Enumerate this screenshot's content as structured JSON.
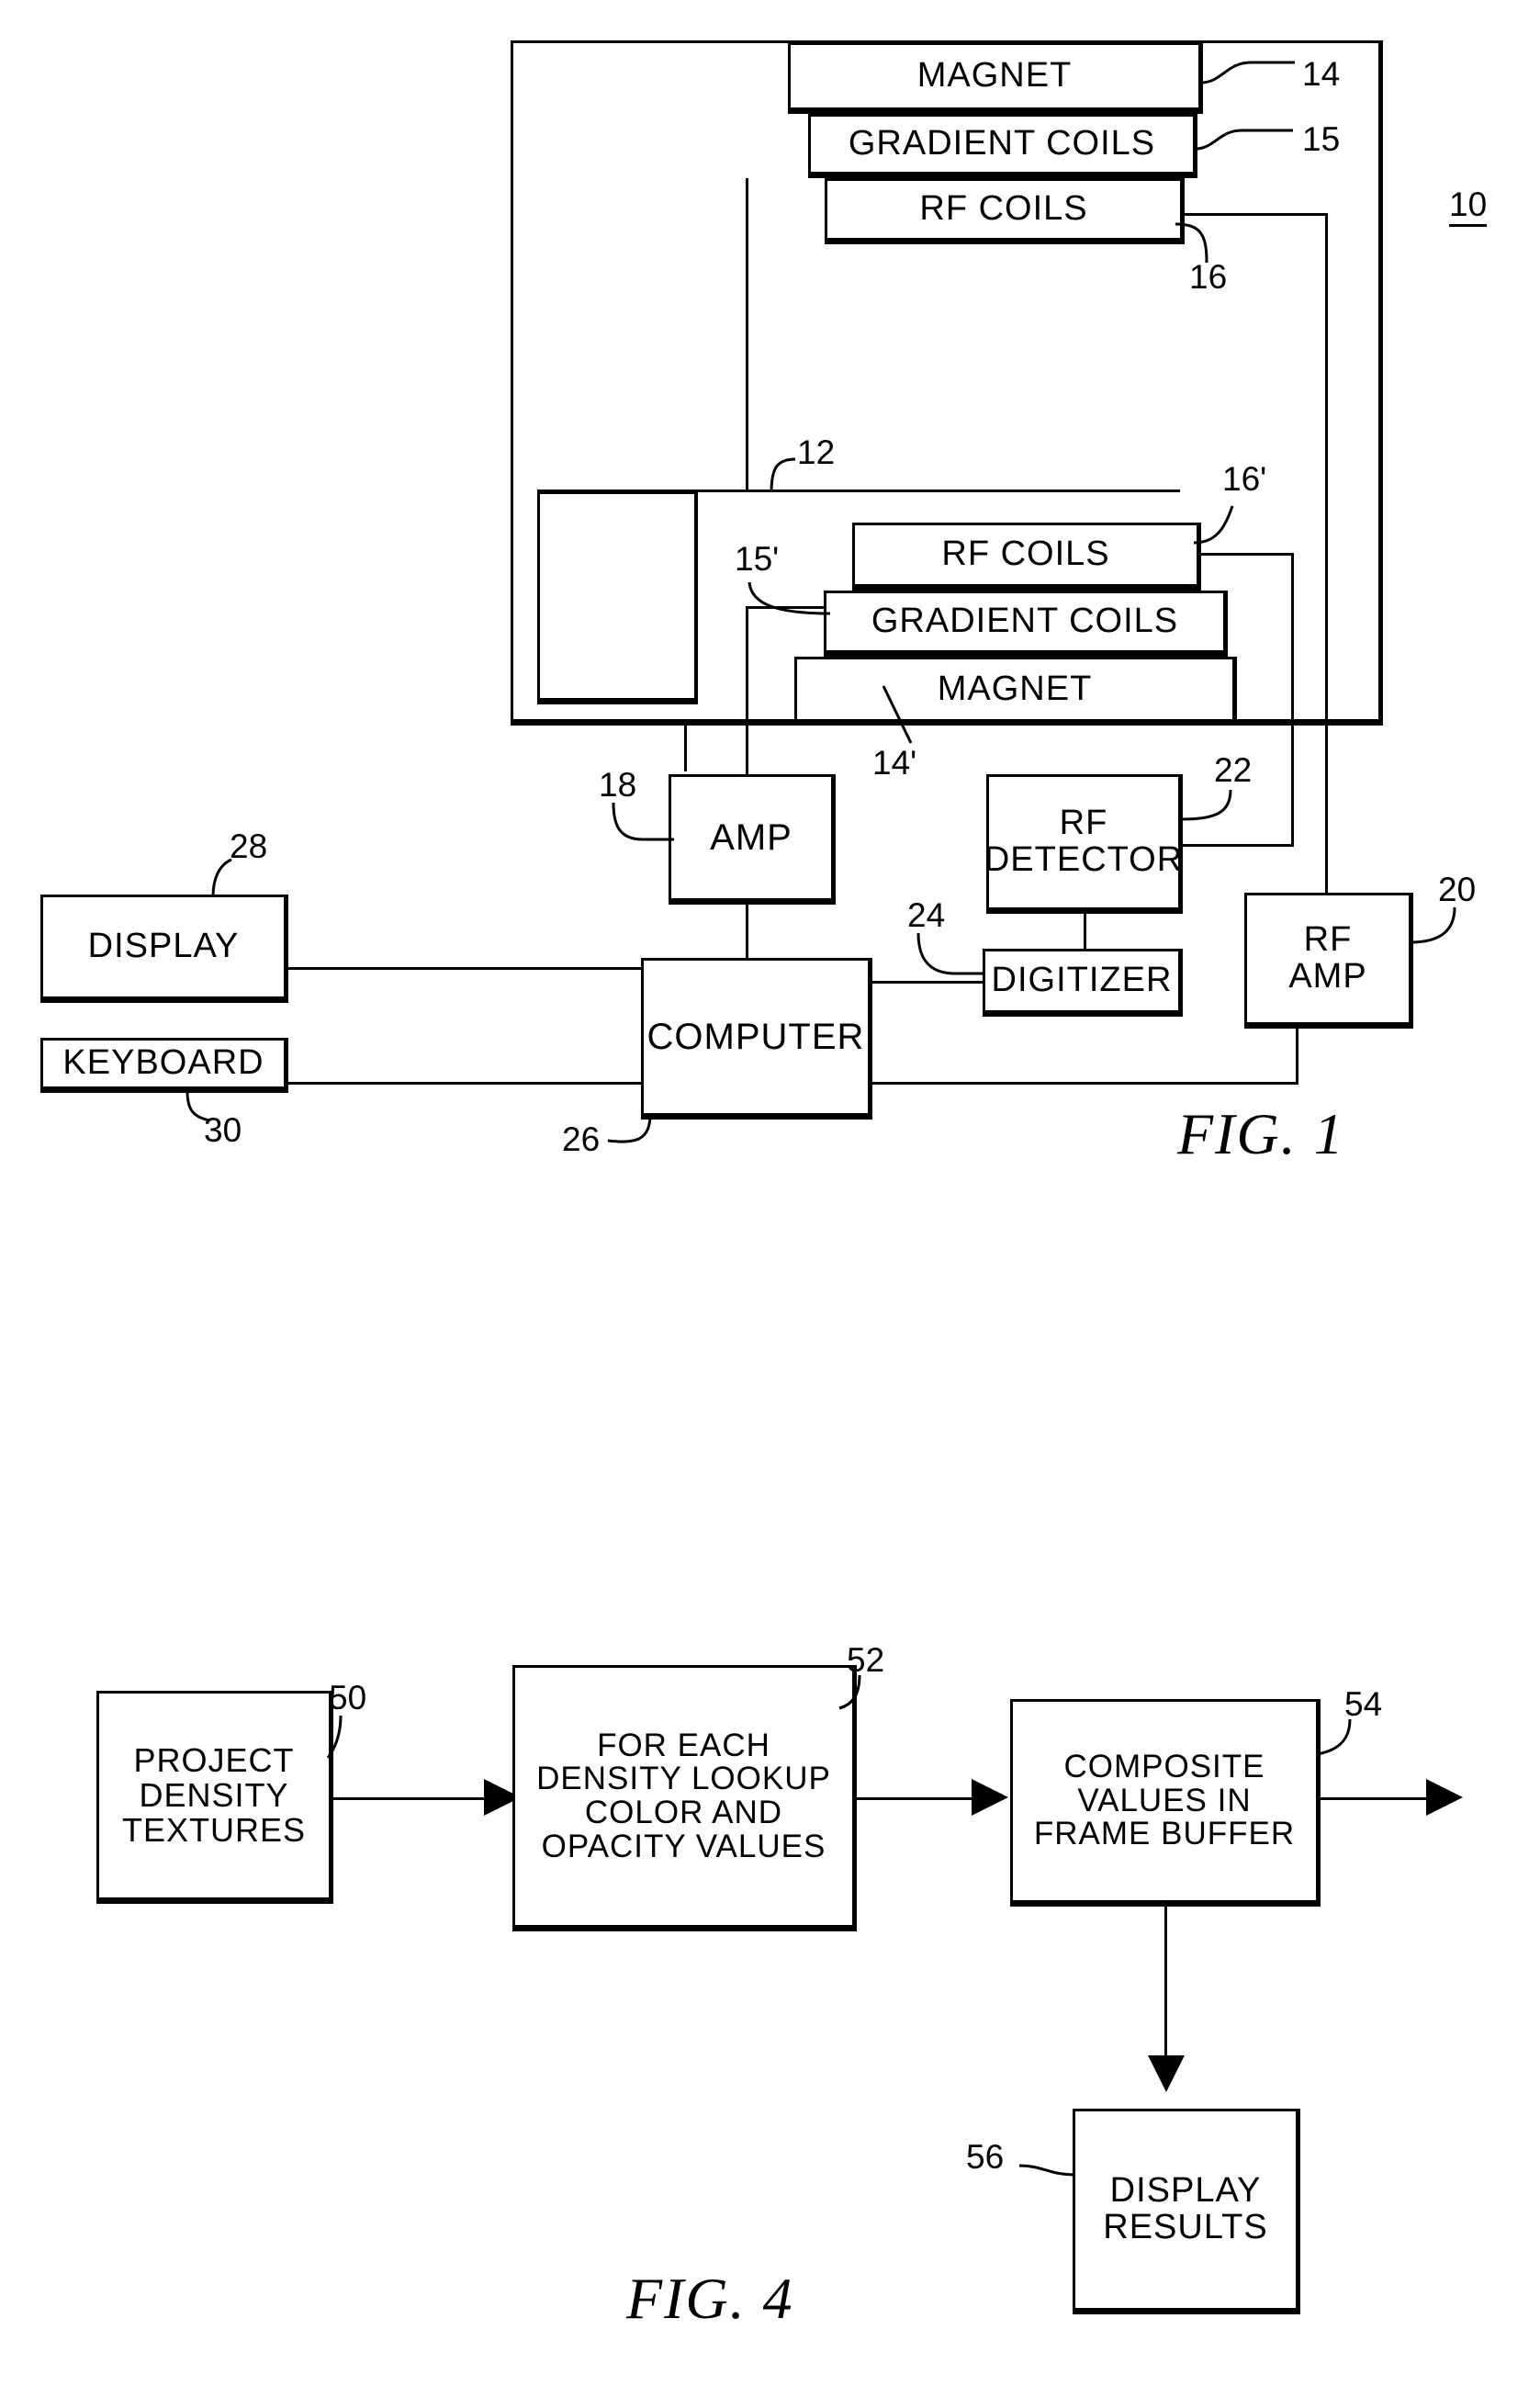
{
  "figures": [
    {
      "caption": "FIG. 1",
      "system_ref": "10",
      "blocks": [
        {
          "id": "magnet_top",
          "label": "MAGNET",
          "ref": "14"
        },
        {
          "id": "gradient_top",
          "label": "GRADIENT COILS",
          "ref": "15"
        },
        {
          "id": "rfcoils_top",
          "label": "RF COILS",
          "ref": "16"
        },
        {
          "id": "patient",
          "label": "",
          "ref": "12"
        },
        {
          "id": "rfcoils_bottom",
          "label": "RF COILS",
          "ref": "16'"
        },
        {
          "id": "gradient_bottom",
          "label": "GRADIENT COILS",
          "ref": "15'"
        },
        {
          "id": "magnet_bottom",
          "label": "MAGNET",
          "ref": "14'"
        },
        {
          "id": "amp",
          "label": "AMP",
          "ref": "18"
        },
        {
          "id": "rf_detector",
          "label": "RF\nDETECTOR",
          "ref": "22"
        },
        {
          "id": "digitizer",
          "label": "DIGITIZER",
          "ref": "24"
        },
        {
          "id": "rf_amp",
          "label": "RF\nAMP",
          "ref": "20"
        },
        {
          "id": "display",
          "label": "DISPLAY",
          "ref": "28"
        },
        {
          "id": "keyboard",
          "label": "KEYBOARD",
          "ref": "30"
        },
        {
          "id": "computer",
          "label": "COMPUTER",
          "ref": "26"
        }
      ]
    },
    {
      "caption": "FIG. 4",
      "blocks": [
        {
          "id": "project_density_textures",
          "label": "PROJECT\nDENSITY\nTEXTURES",
          "ref": "50"
        },
        {
          "id": "lookup_color_opacity",
          "label": "FOR EACH\nDENSITY LOOKUP\nCOLOR AND\nOPACITY VALUES",
          "ref": "52"
        },
        {
          "id": "composite_frame_buffer",
          "label": "COMPOSITE\nVALUES IN\nFRAME BUFFER",
          "ref": "54"
        },
        {
          "id": "display_results",
          "label": "DISPLAY\nRESULTS",
          "ref": "56"
        }
      ]
    }
  ],
  "fig1": {
    "caption": "FIG. 1",
    "system_ref": "10",
    "magnet_top": "MAGNET",
    "magnet_top_ref": "14",
    "gradient_top": "GRADIENT COILS",
    "gradient_top_ref": "15",
    "rfcoils_top": "RF COILS",
    "rfcoils_top_ref": "16",
    "patient_ref": "12",
    "rfcoils_bottom": "RF COILS",
    "rfcoils_bottom_ref": "16'",
    "gradient_bottom": "GRADIENT COILS",
    "gradient_bottom_ref": "15'",
    "magnet_bottom": "MAGNET",
    "magnet_bottom_ref": "14'",
    "amp": "AMP",
    "amp_ref": "18",
    "rf_detector_line1": "RF",
    "rf_detector_line2": "DETECTOR",
    "rf_detector_ref": "22",
    "digitizer": "DIGITIZER",
    "digitizer_ref": "24",
    "rf_amp_line1": "RF",
    "rf_amp_line2": "AMP",
    "rf_amp_ref": "20",
    "display": "DISPLAY",
    "display_ref": "28",
    "keyboard": "KEYBOARD",
    "keyboard_ref": "30",
    "computer": "COMPUTER",
    "computer_ref": "26"
  },
  "fig4": {
    "caption": "FIG. 4",
    "step1_line1": "PROJECT",
    "step1_line2": "DENSITY",
    "step1_line3": "TEXTURES",
    "step1_ref": "50",
    "step2_line1": "FOR EACH",
    "step2_line2": "DENSITY LOOKUP",
    "step2_line3": "COLOR AND",
    "step2_line4": "OPACITY VALUES",
    "step2_ref": "52",
    "step3_line1": "COMPOSITE",
    "step3_line2": "VALUES IN",
    "step3_line3": "FRAME BUFFER",
    "step3_ref": "54",
    "step4_line1": "DISPLAY",
    "step4_line2": "RESULTS",
    "step4_ref": "56"
  },
  "colors": {
    "ink": "#000000",
    "paper": "#ffffff"
  }
}
